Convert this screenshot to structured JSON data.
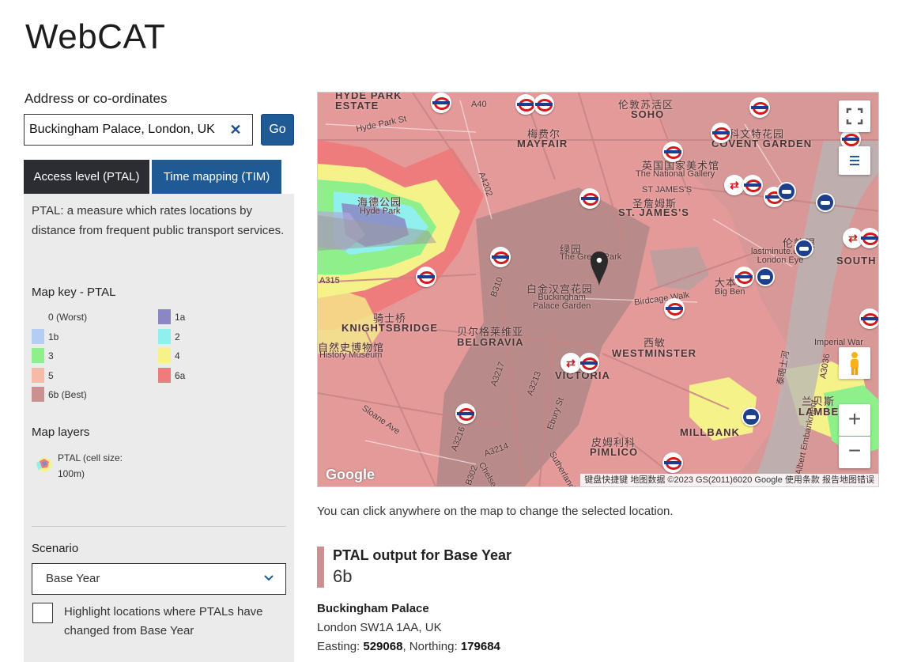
{
  "app": {
    "title": "WebCAT"
  },
  "search": {
    "label": "Address or co-ordinates",
    "value": "Buckingham Palace, London, UK",
    "clear_icon": "close-icon",
    "go_label": "Go"
  },
  "tabs": [
    {
      "label": "Access level (PTAL)",
      "active": true
    },
    {
      "label": "Time mapping (TIM)",
      "active": false
    }
  ],
  "panel": {
    "description": "PTAL: a measure which rates locations by distance from frequent public transport services.",
    "map_key": {
      "heading": "Map key - PTAL",
      "items": [
        {
          "label": "0 (Worst)",
          "color": "#ebebeb"
        },
        {
          "label": "1a",
          "color": "#8b86c4"
        },
        {
          "label": "1b",
          "color": "#b6cdf2"
        },
        {
          "label": "2",
          "color": "#8ff0ee"
        },
        {
          "label": "3",
          "color": "#8df08b"
        },
        {
          "label": "4",
          "color": "#f6f28a"
        },
        {
          "label": "5",
          "color": "#f6bba6"
        },
        {
          "label": "6a",
          "color": "#ee7c7c"
        },
        {
          "label": "6b (Best)",
          "color": "#c99191"
        }
      ]
    },
    "map_layers": {
      "heading": "Map layers",
      "layer_label": "PTAL (cell size: 100m)",
      "layer_icon": "ptal-layer-icon"
    },
    "scenario": {
      "heading": "Scenario",
      "selected": "Base Year",
      "highlight_label": "Highlight locations where PTALs have changed from Base Year",
      "highlight_checked": false
    }
  },
  "map": {
    "labels": {
      "hyde_park_estate": "HYDE PARK\nESTATE",
      "soho_cn": "伦敦苏活区",
      "soho": "SOHO",
      "mayfair_cn": "梅费尔",
      "mayfair": "MAYFAIR",
      "covent_cn": "科文特花园",
      "covent": "COVENT GARDEN",
      "national_gallery_cn": "英国国家美术馆",
      "national_gallery": "The National Gallery",
      "hyde_park_cn": "海德公园",
      "hyde_park": "Hyde Park",
      "st_james_cn": "圣詹姆斯",
      "st_james_upper": "ST JAMES'S",
      "st_james": "ST. JAMES'S",
      "green_park_cn": "绿园",
      "green_park": "The Green Park",
      "london_eye_cn": "伦敦眼",
      "london_eye": "lastminute.com\nLondon Eye",
      "south": "SOUTH",
      "palace_garden_cn": "白金汉宫花园",
      "palace_garden": "Buckingham\nPalace Garden",
      "big_ben_cn": "大本钟",
      "big_ben": "Big Ben",
      "knightsbridge_cn": "骑士桥",
      "knightsbridge": "KNIGHTSBRIDGE",
      "belgravia_cn": "贝尔格莱维亚",
      "belgravia": "BELGRAVIA",
      "westminster_cn": "西敏",
      "westminster": "WESTMINSTER",
      "museum_cn": "自然史博物馆",
      "museum": "History Museum",
      "victoria": "VICTORIA",
      "imperial_war": "Imperial War",
      "lambeth_cn": "兰贝斯",
      "lambeth": "LAMBETH",
      "millbank": "MILLBANK",
      "pimlico_cn": "皮姆利科",
      "pimlico": "PIMLICO",
      "birdcage": "Birdcage Walk",
      "hyde_park_rd": "Hyde Park St",
      "a40": "A40",
      "a4202": "A4202",
      "a315": "A315",
      "b310": "B310",
      "a3217": "A3217",
      "a3213": "A3213",
      "a3214": "A3214",
      "a3216": "A3216",
      "a3036": "A3036",
      "sloane": "Sloane Ave",
      "embankment": "Albert Embankment",
      "river_cn": "泰晤士河",
      "kings_road": "Ebury St",
      "b302": "B302",
      "chelsea": "Chelsea",
      "sutherland": "Sutherland"
    },
    "google_logo": "Google",
    "attribution": "键盘快捷键  地图数据 ©2023 GS(2011)6020 Google  使用条款  报告地图错误",
    "fullscreen_icon": "fullscreen-icon",
    "layers_icon": "menu-icon",
    "pegman_icon": "pegman-icon",
    "zoom_in": "+",
    "zoom_out": "−",
    "pin_icon": "location-pin-icon",
    "station_icon": "underground-icon",
    "rail_icon": "national-rail-icon",
    "river_icon": "river-bus-icon"
  },
  "map_note": "You can click anywhere on the map to change the selected location.",
  "result": {
    "title": "PTAL output for Base Year",
    "value": "6b",
    "place_name": "Buckingham Palace",
    "address": "London SW1A 1AA, UK",
    "easting_label": "Easting:",
    "easting": "529068",
    "northing_label": "Northing:",
    "northing": "179684"
  }
}
